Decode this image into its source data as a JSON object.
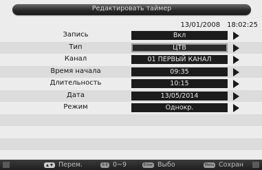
{
  "title": "Редактировать таймер",
  "date": "13/01/2008",
  "time": "18:02:25",
  "fields": [
    {
      "label": "Запись",
      "value": "Вкл"
    },
    {
      "label": "Тип",
      "value": "ЦТВ"
    },
    {
      "label": "Канал",
      "value": "01 ПЕРВЫЙ КАНАЛ"
    },
    {
      "label": "Время начала",
      "value": "09:35"
    },
    {
      "label": "Длительность",
      "value": "10:15"
    },
    {
      "label": "Дата",
      "value": "13/05/2014"
    },
    {
      "label": "Режим",
      "value": "Однокр."
    }
  ],
  "footer": {
    "move": "Перем.",
    "digits": "0~9",
    "select": "Выбо",
    "save": "Сохран",
    "key_num": "0-9",
    "key_enter": "Enter",
    "key_menu": "Menu"
  }
}
